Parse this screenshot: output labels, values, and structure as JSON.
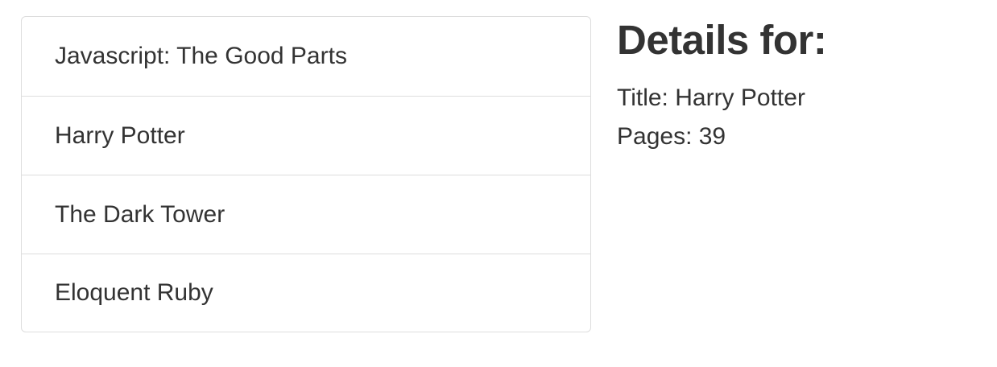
{
  "books": {
    "items": [
      {
        "title": "Javascript: The Good Parts"
      },
      {
        "title": "Harry Potter"
      },
      {
        "title": "The Dark Tower"
      },
      {
        "title": "Eloquent Ruby"
      }
    ]
  },
  "details": {
    "heading": "Details for:",
    "title_line": "Title: Harry Potter",
    "pages_line": "Pages: 39"
  }
}
